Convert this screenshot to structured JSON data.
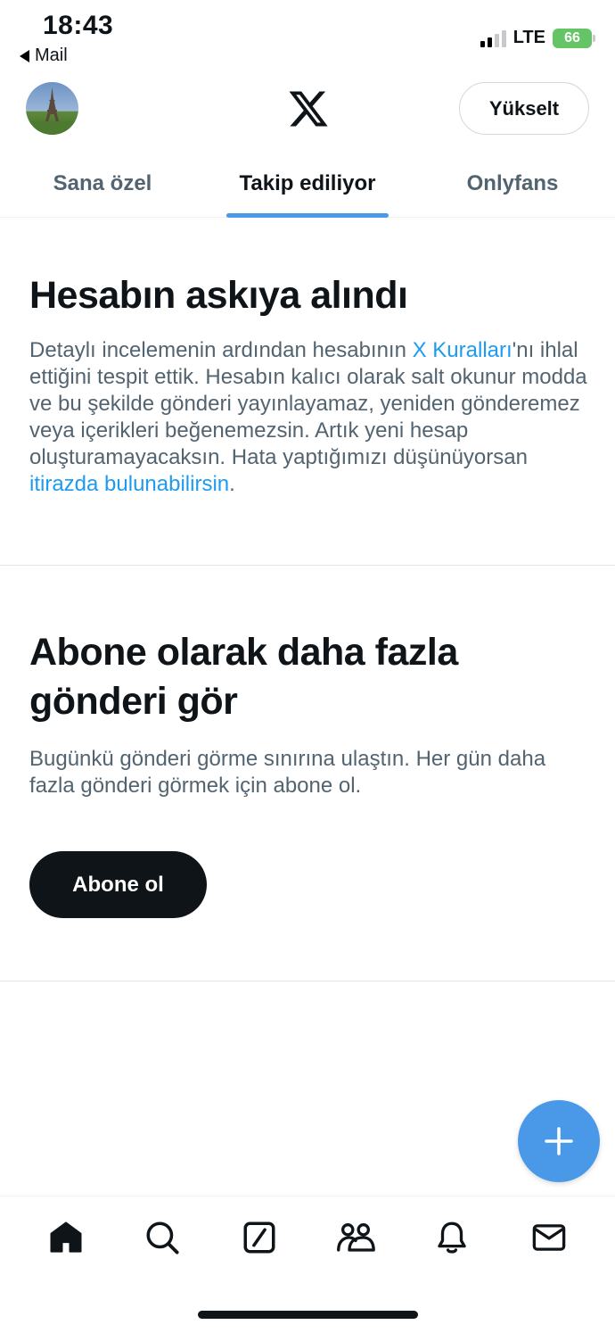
{
  "status_bar": {
    "time": "18:43",
    "back_app": "Mail",
    "network": "LTE",
    "battery": "66"
  },
  "header": {
    "upgrade_label": "Yükselt",
    "logo_icon": "x-logo-icon"
  },
  "tabs": [
    {
      "label": "Sana özel",
      "active": false
    },
    {
      "label": "Takip ediliyor",
      "active": true
    },
    {
      "label": "Onlyfans",
      "active": false
    }
  ],
  "suspension": {
    "title": "Hesabın askıya alındı",
    "body_pre": "Detaylı incelemenin ardından hesabının ",
    "rules_link": "X Kuralları",
    "body_mid": "'nı ihlal ettiğini tespit ettik. Hesabın kalıcı olarak salt okunur modda ve bu şekilde gönderi yayınlayamaz, yeniden gönderemez veya içerikleri beğenemezsin. Artık yeni hesap oluşturamayacaksın. Hata yaptığımızı düşünüyorsan ",
    "appeal_link": "itirazda bulunabilirsin",
    "body_post": "."
  },
  "subscribe": {
    "title": "Abone olarak daha fazla gönderi gör",
    "body": "Bugünkü gönderi görme sınırına ulaştın. Her gün daha fazla gönderi görmek için abone ol.",
    "button_label": "Abone ol"
  },
  "bottom_nav": [
    "home-icon",
    "search-icon",
    "grok-icon",
    "communities-icon",
    "notifications-icon",
    "messages-icon"
  ],
  "colors": {
    "accent": "#1d9bf0",
    "tab_indicator": "#4a99e9",
    "text_primary": "#0f1419",
    "text_secondary": "#536471"
  }
}
